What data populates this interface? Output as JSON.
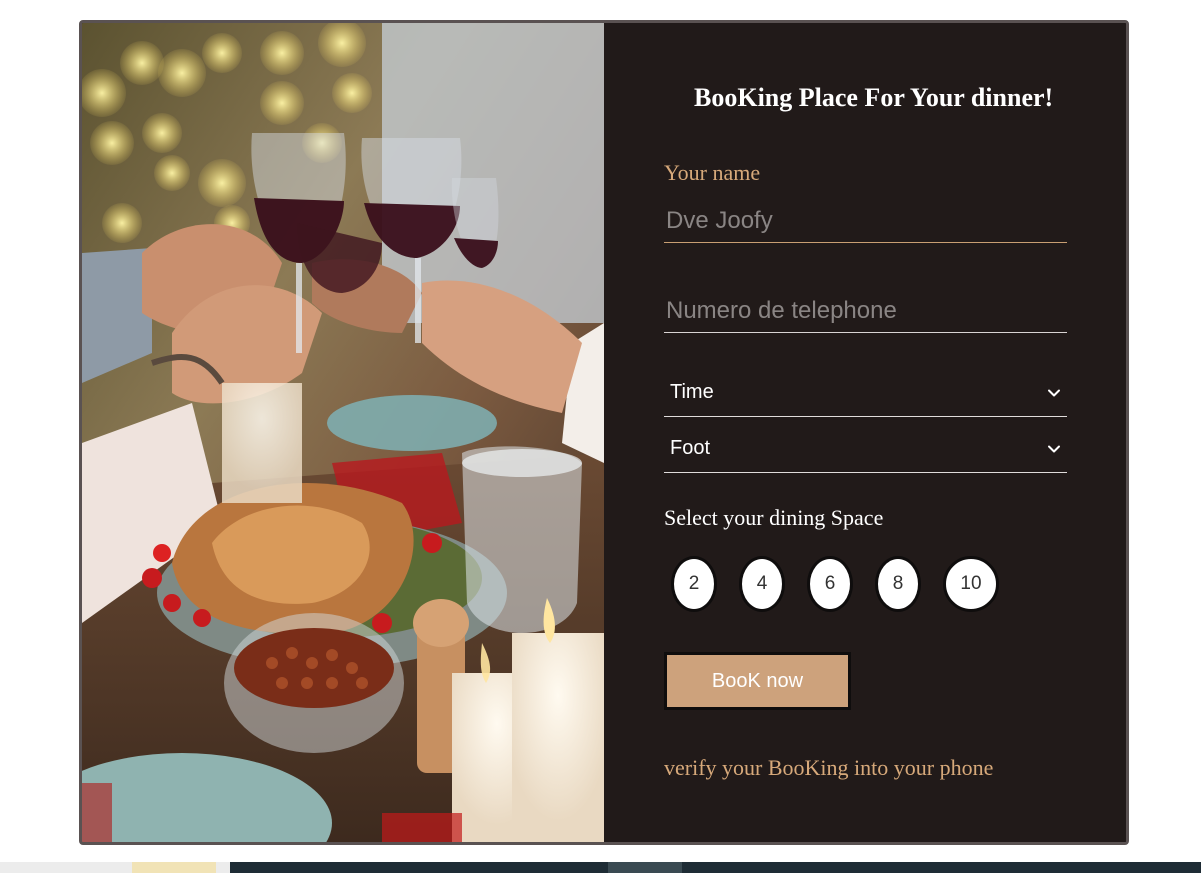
{
  "form": {
    "title": "BooKing Place For Your dinner!",
    "name_label": "Your name",
    "name_placeholder": "Dve Joofy",
    "phone_placeholder": "Numero de telephone",
    "time_select": {
      "selected": "Time",
      "icon": "chevron-down-icon"
    },
    "food_select": {
      "selected": "Foot",
      "icon": "chevron-down-icon"
    },
    "dining_label": "Select your dining Space",
    "spaces": [
      "2",
      "4",
      "6",
      "8",
      "10"
    ],
    "book_button": "BooK now",
    "verify_text": "verify your BooKing into your phone"
  },
  "photo": {
    "description_icon": "dinner-photo"
  },
  "colors": {
    "panel_bg": "#211a19",
    "accent": "#cda27c",
    "label_accent": "#d7a97a",
    "text": "#ffffff"
  }
}
